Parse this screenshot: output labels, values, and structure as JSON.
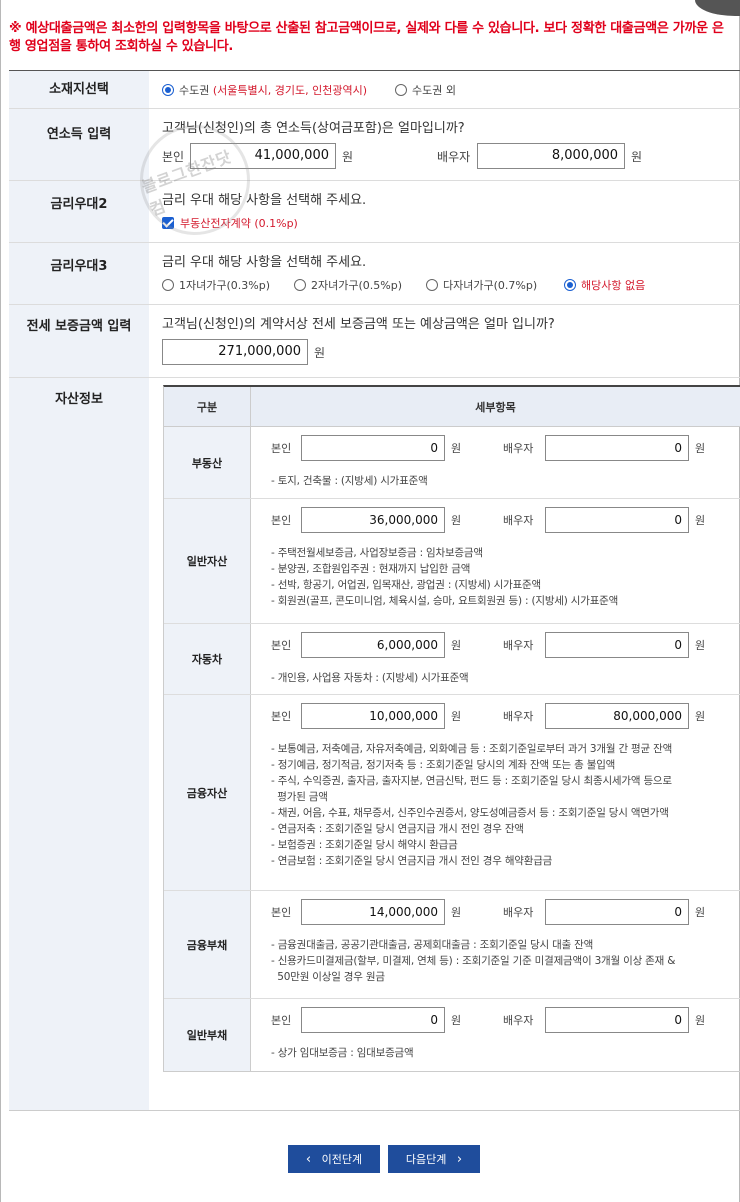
{
  "notice": "※ 예상대출금액은 최소한의 입력항목을 바탕으로 산출된 참고금액이므로, 실제와 다를 수 있습니다. 보다 정확한 대출금액은 가까운 은행 영업점을 통하여 조회하실 수 있습니다.",
  "location": {
    "label": "소재지선택",
    "options": [
      {
        "label": "수도권",
        "detail": "(서울특별시, 경기도, 인천광역시)",
        "selected": true
      },
      {
        "label": "수도권 외",
        "detail": "",
        "selected": false
      }
    ]
  },
  "income": {
    "label": "연소득 입력",
    "question": "고객님(신청인)의 총 연소득(상여금포함)은 얼마입니까?",
    "self_label": "본인",
    "self_value": "41,000,000",
    "spouse_label": "배우자",
    "spouse_value": "8,000,000",
    "unit": "원"
  },
  "rate2": {
    "label": "금리우대2",
    "question": "금리 우대 해당 사항을 선택해 주세요.",
    "checkbox_label": "부동산전자계약 (0.1%p)",
    "checked": true
  },
  "rate3": {
    "label": "금리우대3",
    "question": "금리 우대 해당 사항을 선택해 주세요.",
    "options": [
      {
        "label": "1자녀가구(0.3%p)",
        "selected": false
      },
      {
        "label": "2자녀가구(0.5%p)",
        "selected": false
      },
      {
        "label": "다자녀가구(0.7%p)",
        "selected": false
      },
      {
        "label": "해당사항 없음",
        "selected": true
      }
    ]
  },
  "deposit": {
    "label": "전세 보증금액 입력",
    "question": "고객님(신청인)의 계약서상 전세 보증금액 또는 예상금액은 얼마 입니까?",
    "value": "271,000,000",
    "unit": "원"
  },
  "assets": {
    "label": "자산정보",
    "col_category": "구분",
    "col_detail": "세부항목",
    "self_label": "본인",
    "spouse_label": "배우자",
    "unit": "원",
    "rows": [
      {
        "category": "부동산",
        "self": "0",
        "spouse": "0",
        "notes": [
          "- 토지, 건축물 : (지방세) 시가표준액"
        ]
      },
      {
        "category": "일반자산",
        "self": "36,000,000",
        "spouse": "0",
        "notes": [
          "- 주택전월세보증금, 사업장보증금 : 임차보증금액",
          "- 분양권, 조합원입주권 : 현재까지 납입한 금액",
          "- 선박, 항공기, 어업권, 입목재산, 광업권 : (지방세) 시가표준액",
          "- 회원권(골프, 콘도미니엄, 체육시설, 승마, 요트회원권 등) : (지방세) 시가표준액"
        ]
      },
      {
        "category": "자동차",
        "self": "6,000,000",
        "spouse": "0",
        "notes": [
          "- 개인용, 사업용 자동차 : (지방세) 시가표준액"
        ]
      },
      {
        "category": "금융자산",
        "self": "10,000,000",
        "spouse": "80,000,000",
        "notes": [
          "- 보통예금, 저축예금, 자유저축예금, 외화예금 등 : 조회기준일로부터 과거 3개월 간 평균 잔액",
          "- 정기예금, 정기적금, 정기저축 등 : 조회기준일 당시의 계좌 잔액 또는 총 불입액",
          "- 주식, 수익증권, 출자금, 출자지분, 연금신탁, 펀드 등 : 조회기준일 당시 최종시세가액 등으로",
          "  평가된 금액",
          "- 채권, 어음, 수표, 채무증서, 신주인수권증서, 양도성예금증서 등 : 조회기준일 당시 액면가액",
          "- 연금저축 : 조회기준일 당시 연금지급 개시 전인 경우 잔액",
          "- 보험증권 : 조회기준일 당시 해약시 환급금",
          "- 연금보험 : 조회기준일 당시 연금지급 개시 전인 경우 해약환급금"
        ]
      },
      {
        "category": "금융부채",
        "self": "14,000,000",
        "spouse": "0",
        "notes": [
          "- 금융권대출금, 공공기관대출금, 공제회대출금 : 조회기준일 당시 대출 잔액",
          "- 신용카드미결제금(할부, 미결제, 연체 등) : 조회기준일 기준 미결제금액이 3개월 이상 존재 &",
          "  50만원 이상일 경우 원금"
        ]
      },
      {
        "category": "일반부채",
        "self": "0",
        "spouse": "0",
        "notes": [
          "- 상가 임대보증금 : 임대보증금액"
        ]
      }
    ]
  },
  "buttons": {
    "prev": "이전단계",
    "next": "다음단계"
  },
  "watermark": "블로그한잔닷컴"
}
